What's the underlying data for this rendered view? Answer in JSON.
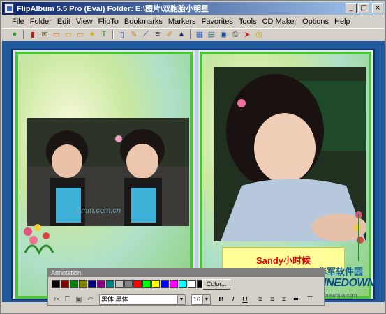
{
  "window": {
    "title": "FlipAlbum 5.5 Pro (Eval)    Folder: E:\\图片\\双胞胎小明星",
    "controls": {
      "minimize": "_",
      "maximize": "□",
      "close": "×"
    }
  },
  "menu": [
    "File",
    "Folder",
    "Edit",
    "View",
    "FlipTo",
    "Bookmarks",
    "Markers",
    "Favorites",
    "Tools",
    "CD Maker",
    "Options",
    "Help"
  ],
  "toolbar": {
    "icons": [
      "play-icon",
      "book-icon",
      "envelope-icon",
      "folder-open-icon",
      "folder-icon",
      "folder-up-icon",
      "star-icon",
      "text-icon",
      "pages-icon",
      "tag-icon",
      "pen-icon",
      "list-icon",
      "pencil-icon",
      "cursor-icon",
      "image-icon",
      "arrange-icon",
      "globe-icon",
      "printer-icon",
      "pointer-icon",
      "burn-icon"
    ],
    "glyphs": [
      "●",
      "▮",
      "✉",
      "▭",
      "▭",
      "▭",
      "✦",
      "T",
      "▯",
      "✎",
      "⟋",
      "≡",
      "✐",
      "▲",
      "▦",
      "▤",
      "◉",
      "⎙",
      "➤",
      "◎"
    ],
    "colors": [
      "#2a9a2a",
      "#b02020",
      "#6a5a2a",
      "#d47a1a",
      "#e0a040",
      "#c88a2a",
      "#d8b000",
      "#2a8a2a",
      "#2040c0",
      "#c08020",
      "#2040a0",
      "#404060",
      "#c08040",
      "#202060",
      "#3060c0",
      "#406080",
      "#2050a0",
      "#404040",
      "#c02020",
      "#d0a000"
    ]
  },
  "album": {
    "left_photo_watermark": "pmm.com.cn",
    "right_caption": "Sandy小时候"
  },
  "annotation": {
    "title": "Annotation",
    "swatches": [
      "#000000",
      "#800000",
      "#008000",
      "#808000",
      "#000080",
      "#800080",
      "#008080",
      "#c0c0c0",
      "#808080",
      "#ff0000",
      "#00ff00",
      "#ffff00",
      "#0000ff",
      "#ff00ff",
      "#00ffff",
      "#ffffff",
      "#000000"
    ],
    "color_button": "Color...",
    "font_name": "黑体  黑体",
    "font_size": "16",
    "bold": "B",
    "italic": "I",
    "underline": "U"
  },
  "logo": {
    "cn": "华军软件园",
    "en": "ONLINEDOWN",
    "url": "www.newhua.com"
  }
}
